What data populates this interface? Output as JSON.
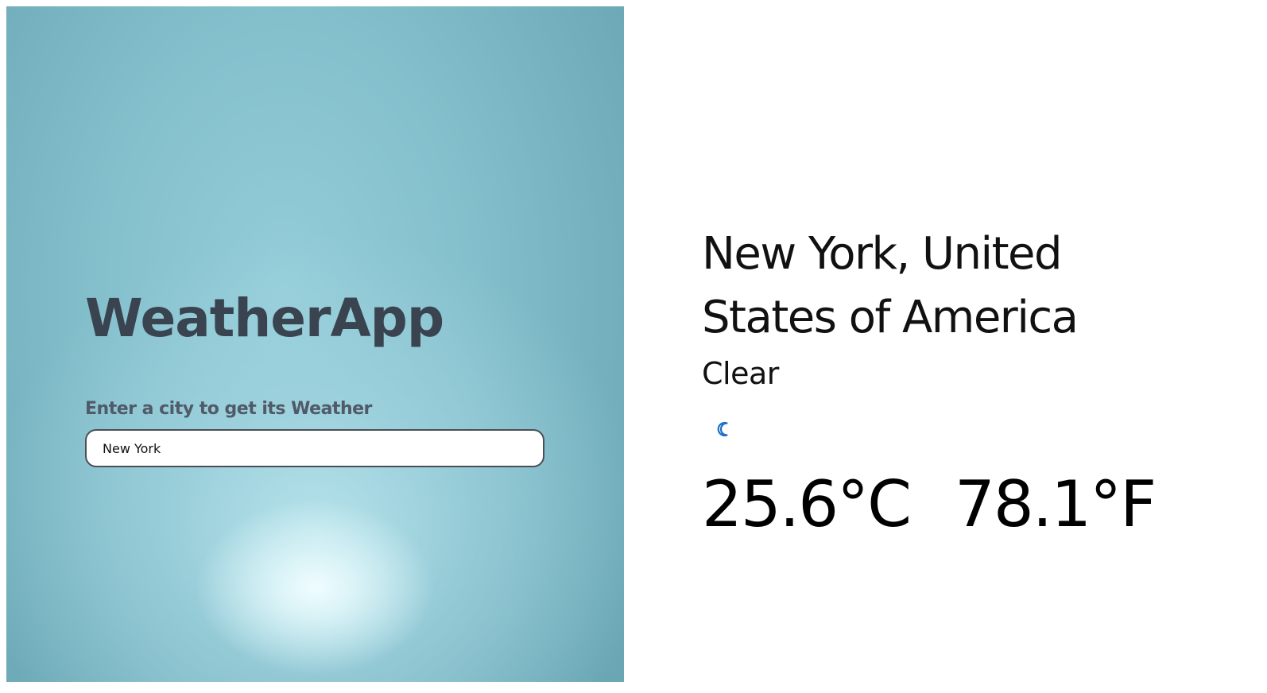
{
  "search": {
    "title": "WeatherApp",
    "label": "Enter a city to get its Weather",
    "input_value": "New York"
  },
  "weather": {
    "location": "New York, United States of America",
    "condition": "Clear",
    "icon": "crescent-moon-icon",
    "temp_c": "25.6°C",
    "temp_f": "78.1°F"
  },
  "colors": {
    "panel_gradient_edge": "#6aa6b4",
    "panel_gradient_mid": "#94cdd9",
    "glow": "#f0fdff",
    "title_text": "#3a4450",
    "label_text": "#505a69",
    "moon_icon": "#1e6fc8"
  }
}
